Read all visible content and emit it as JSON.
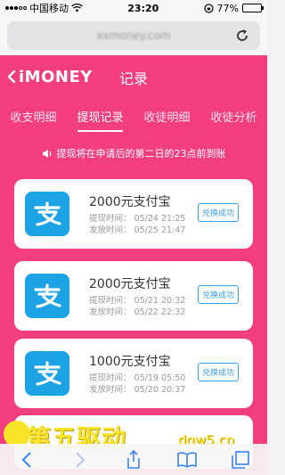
{
  "status_bar": {
    "carrier": "中国移动",
    "time": "23:20",
    "battery": "77%",
    "battery_level": 0.77
  },
  "browser": {
    "url": "xxmoney.com"
  },
  "header": {
    "brand": "iMONEY",
    "title": "记录"
  },
  "tabs": [
    {
      "label": "收支明细"
    },
    {
      "label": "提现记录"
    },
    {
      "label": "收徒明细"
    },
    {
      "label": "收徒分析"
    }
  ],
  "notice": "提现将在申请后的第二日的23点前到账",
  "records": [
    {
      "amount": "2000元支付宝",
      "apply_label": "提现时间：",
      "apply_time": "05/24 21:25",
      "payout_label": "发放时间：",
      "payout_time": "05/25 21:47",
      "status": "兑换成功"
    },
    {
      "amount": "2000元支付宝",
      "apply_label": "提现时间：",
      "apply_time": "05/21 20:32",
      "payout_label": "发放时间：",
      "payout_time": "05/22 22:32",
      "status": "兑换成功"
    },
    {
      "amount": "1000元支付宝",
      "apply_label": "提现时间：",
      "apply_time": "05/19 05:50",
      "payout_label": "发放时间：",
      "payout_time": "05/20 20:37",
      "status": "兑换成功"
    }
  ],
  "watermark": {
    "text": "第五驱动",
    "url": "dqw5.cn"
  },
  "colors": {
    "accent": "#f23d7e",
    "alipay": "#1ba3e6",
    "badge": "#3aa0e6"
  }
}
